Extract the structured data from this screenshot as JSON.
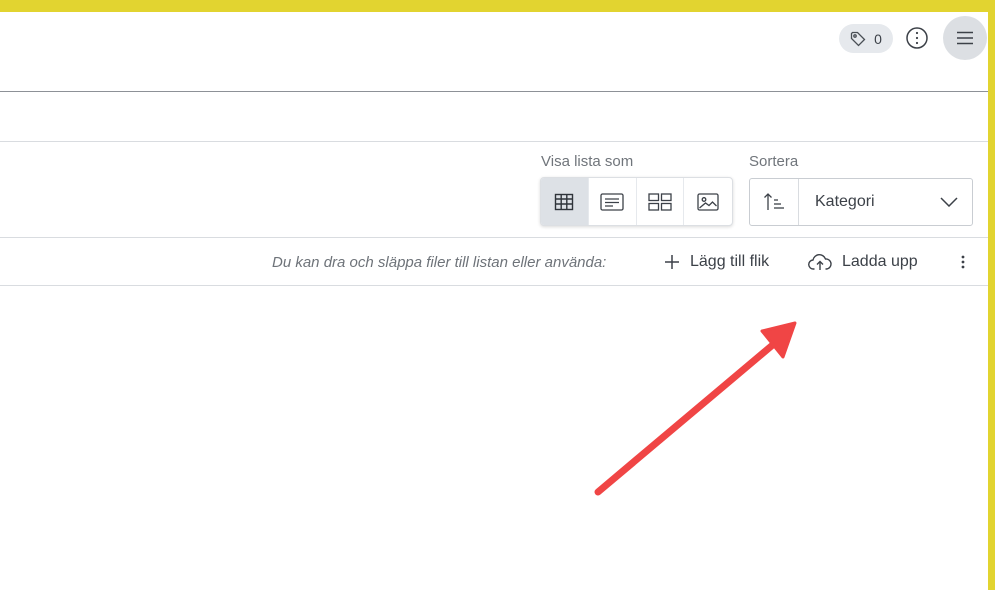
{
  "header": {
    "tag_count": "0",
    "icons": {
      "tag": "tag-icon",
      "info": "more-vertical-circle-icon",
      "menu": "hamburger-menu-icon"
    }
  },
  "view": {
    "label": "Visa lista som",
    "options": [
      {
        "icon": "table-grid-icon",
        "active": true
      },
      {
        "icon": "text-list-icon",
        "active": false
      },
      {
        "icon": "tiles-icon",
        "active": false
      },
      {
        "icon": "image-gallery-icon",
        "active": false
      }
    ]
  },
  "sort": {
    "label": "Sortera",
    "selected": "Kategori",
    "icons": {
      "direction": "sort-ascending-icon",
      "dropdown": "chevron-down-icon"
    }
  },
  "actions": {
    "hint": "Du kan dra och släppa filer till listan eller använda:",
    "add_tab": "Lägg till flik",
    "upload": "Ladda upp",
    "icons": {
      "add": "plus-icon",
      "upload": "cloud-upload-icon",
      "more": "kebab-menu-icon"
    }
  },
  "colors": {
    "highlight_border": "#e2d430",
    "annotation_arrow": "#f04545",
    "active_view": "#dde1e6"
  }
}
